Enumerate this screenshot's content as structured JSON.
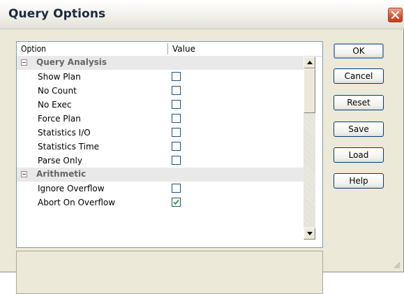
{
  "window": {
    "title": "Query Options"
  },
  "grid": {
    "columns": [
      "Option",
      "Value"
    ],
    "rows": [
      {
        "type": "category",
        "label": "Query Analysis",
        "expanded": true
      },
      {
        "type": "option",
        "label": "Show Plan",
        "checked": false
      },
      {
        "type": "option",
        "label": "No Count",
        "checked": false
      },
      {
        "type": "option",
        "label": "No Exec",
        "checked": false
      },
      {
        "type": "option",
        "label": "Force Plan",
        "checked": false
      },
      {
        "type": "option",
        "label": "Statistics I/O",
        "checked": false
      },
      {
        "type": "option",
        "label": "Statistics Time",
        "checked": false
      },
      {
        "type": "option",
        "label": "Parse Only",
        "checked": false
      },
      {
        "type": "category",
        "label": "Arithmetic",
        "expanded": true
      },
      {
        "type": "option",
        "label": "Ignore Overflow",
        "checked": false
      },
      {
        "type": "option",
        "label": "Abort On Overflow",
        "checked": true
      }
    ]
  },
  "buttons": {
    "ok": "OK",
    "cancel": "Cancel",
    "reset": "Reset",
    "save": "Save",
    "load": "Load",
    "help": "Help"
  },
  "description": "",
  "colors": {
    "dialog_bg": "#ece9d8",
    "category_bg": "#e9e9e9",
    "checkbox_border": "#1c5180",
    "check_mark": "#21a121",
    "close_button": "#d7542f"
  }
}
